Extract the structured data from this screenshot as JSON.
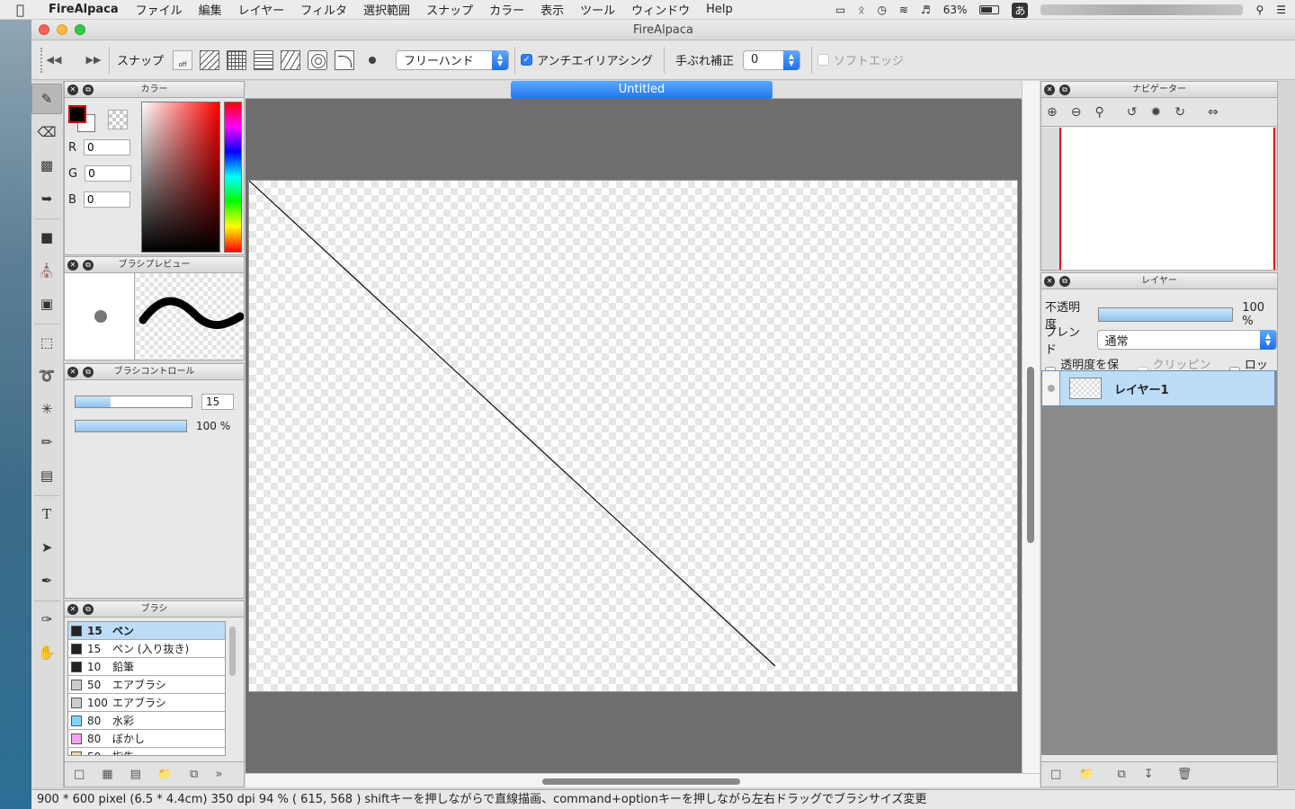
{
  "menubar": {
    "app": "FireAlpaca",
    "items": [
      "ファイル",
      "編集",
      "レイヤー",
      "フィルタ",
      "選択範囲",
      "スナップ",
      "カラー",
      "表示",
      "ツール",
      "ウィンドウ",
      "Help"
    ],
    "battery": "63%",
    "input_mode": "あ"
  },
  "window": {
    "title": "FireAlpaca"
  },
  "toolbar": {
    "snap_label": "スナップ",
    "snap_off_label": "off",
    "brush_mode": "フリーハンド",
    "antialias_label": "アンチエイリアシング",
    "stabilizer_label": "手ぶれ補正",
    "stabilizer_value": "0",
    "soft_edge_label": "ソフトエッジ"
  },
  "color_panel": {
    "title": "カラー",
    "r_label": "R",
    "g_label": "G",
    "b_label": "B",
    "r": "0",
    "g": "0",
    "b": "0"
  },
  "brush_preview": {
    "title": "ブラシプレビュー"
  },
  "brush_control": {
    "title": "ブラシコントロール",
    "size": "15",
    "opacity": "100 %",
    "size_fraction": 0.3,
    "opacity_fraction": 1.0
  },
  "brush_panel": {
    "title": "ブラシ",
    "items": [
      {
        "size": "15",
        "name": "ペン",
        "color": "#222222",
        "selected": true
      },
      {
        "size": "15",
        "name": "ペン (入り抜き)",
        "color": "#222222"
      },
      {
        "size": "10",
        "name": "鉛筆",
        "color": "#222222"
      },
      {
        "size": "50",
        "name": "エアブラシ",
        "color": "#cccccc"
      },
      {
        "size": "100",
        "name": "エアブラシ",
        "color": "#cccccc"
      },
      {
        "size": "80",
        "name": "水彩",
        "color": "#7fd4f5"
      },
      {
        "size": "80",
        "name": "ぼかし",
        "color": "#f5a0f0"
      },
      {
        "size": "50",
        "name": "指先",
        "color": "#f5d5b0"
      }
    ]
  },
  "canvas": {
    "doc_title": "Untitled"
  },
  "navigator": {
    "title": "ナビゲーター"
  },
  "layer_panel": {
    "title": "レイヤー",
    "opacity_label": "不透明度",
    "opacity_value": "100 %",
    "blend_label": "ブレンド",
    "blend_value": "通常",
    "protect_label": "透明度を保護",
    "clipping_label": "クリッピング",
    "lock_label": "ロック",
    "layers": [
      {
        "name": "レイヤー1"
      }
    ]
  },
  "status": {
    "text": "900 * 600 pixel   (6.5 * 4.4cm)   350 dpi   94 %   ( 615, 568 )   shiftキーを押しながらで直線描画、command+optionキーを押しながら左右ドラッグでブラシサイズ変更"
  }
}
